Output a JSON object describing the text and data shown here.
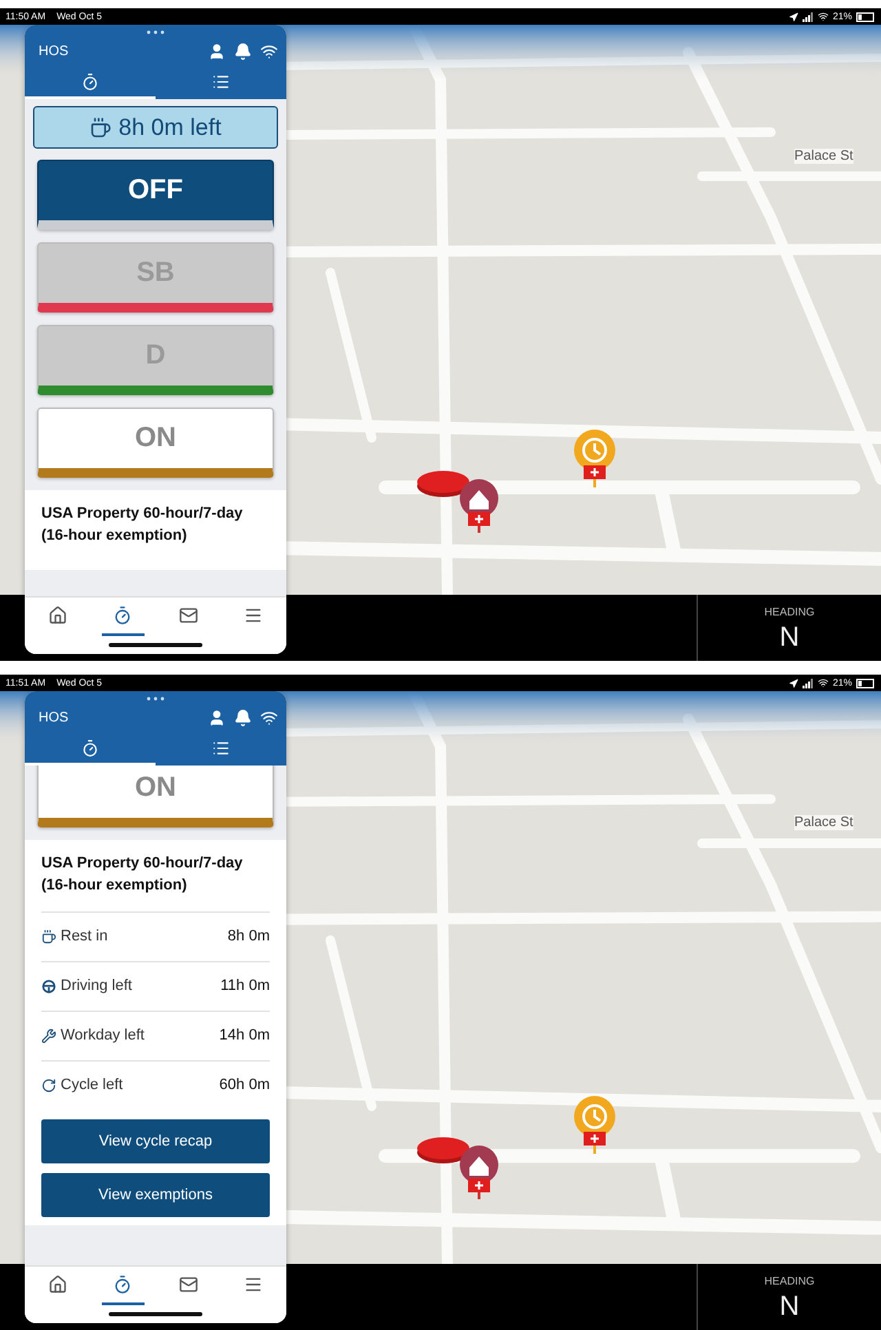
{
  "screens": [
    {
      "status_bar": {
        "time": "11:50 AM",
        "date": "Wed Oct 5",
        "battery": "21%"
      },
      "map": {
        "street": "Palace St"
      },
      "heading": {
        "label": "HEADING",
        "value": "N"
      },
      "panel": {
        "title": "HOS",
        "scrolled": false,
        "tabs": [
          {
            "kind": "timer",
            "selected": true
          },
          {
            "kind": "list",
            "selected": false
          }
        ],
        "rest_badge": "8h 0m left",
        "statuses": [
          {
            "label": "OFF",
            "selected": true,
            "disabled": false,
            "color": "#c9cdd2"
          },
          {
            "label": "SB",
            "selected": false,
            "disabled": true,
            "color": "#e0384f"
          },
          {
            "label": "D",
            "selected": false,
            "disabled": true,
            "color": "#2e8b2e"
          },
          {
            "label": "ON",
            "selected": false,
            "disabled": false,
            "color": "#b37a1c"
          }
        ],
        "ruleset": "USA Property 60-hour/7-day (16-hour exemption)",
        "nav": [
          {
            "kind": "home",
            "selected": false
          },
          {
            "kind": "timer",
            "selected": true
          },
          {
            "kind": "mail",
            "selected": false
          },
          {
            "kind": "menu",
            "selected": false
          }
        ]
      }
    },
    {
      "status_bar": {
        "time": "11:51 AM",
        "date": "Wed Oct 5",
        "battery": "21%"
      },
      "map": {
        "street": "Palace St"
      },
      "heading": {
        "label": "HEADING",
        "value": "N"
      },
      "panel": {
        "title": "HOS",
        "scrolled": true,
        "tabs": [
          {
            "kind": "timer",
            "selected": true
          },
          {
            "kind": "list",
            "selected": false
          }
        ],
        "statuses": [
          {
            "label": "ON",
            "selected": false,
            "disabled": false,
            "color": "#b37a1c"
          }
        ],
        "ruleset": "USA Property 60-hour/7-day (16-hour exemption)",
        "rows": [
          {
            "kind": "rest",
            "label": "Rest in",
            "value": "8h 0m"
          },
          {
            "kind": "driving",
            "label": "Driving left",
            "value": "11h 0m"
          },
          {
            "kind": "workday",
            "label": "Workday left",
            "value": "14h 0m"
          },
          {
            "kind": "cycle",
            "label": "Cycle left",
            "value": "60h 0m"
          }
        ],
        "buttons": [
          "View cycle recap",
          "View exemptions"
        ],
        "nav": [
          {
            "kind": "home",
            "selected": false
          },
          {
            "kind": "timer",
            "selected": true
          },
          {
            "kind": "mail",
            "selected": false
          },
          {
            "kind": "menu",
            "selected": false
          }
        ]
      }
    }
  ]
}
